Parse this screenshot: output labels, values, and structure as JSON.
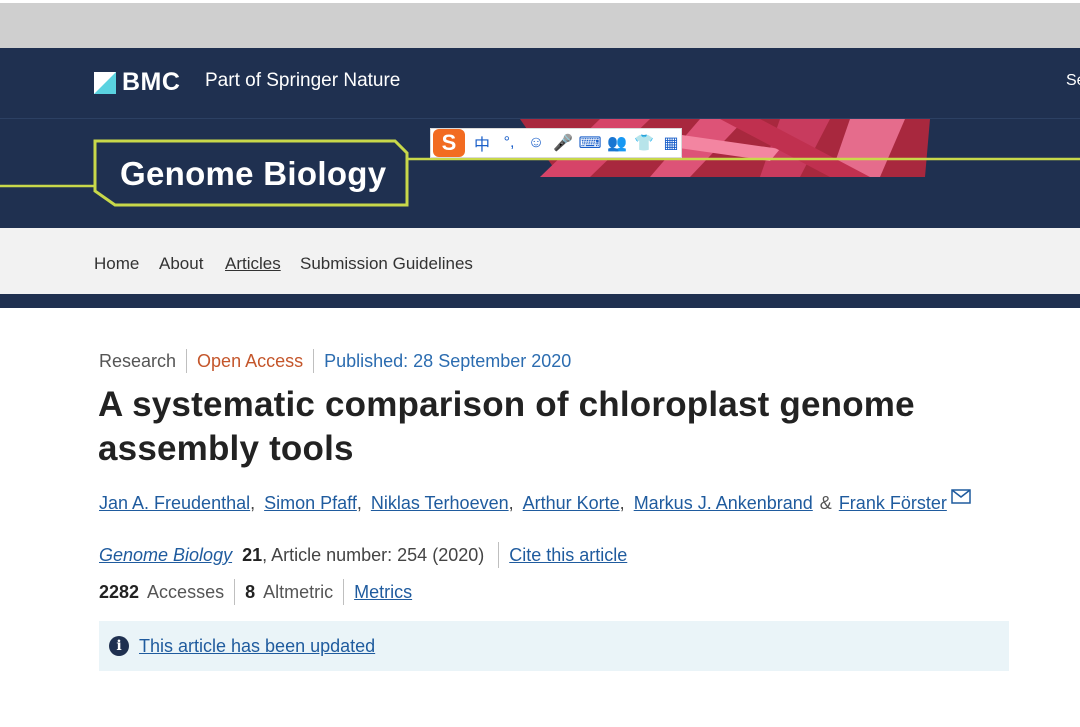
{
  "brand": {
    "logo_text": "BMC",
    "subtitle": "Part of Springer Nature",
    "right_text": "Se"
  },
  "journal": {
    "title": "Genome Biology"
  },
  "ime_toolbar": {
    "logo": "S",
    "items": [
      "中",
      "°,",
      "☺",
      "🎤",
      "⌨",
      "👥",
      "👕",
      "▦"
    ]
  },
  "nav": {
    "items": [
      "Home",
      "About",
      "Articles",
      "Submission Guidelines"
    ],
    "active": "Articles"
  },
  "article": {
    "type": "Research",
    "access": "Open Access",
    "published": "Published: 28 September 2020",
    "title": "A systematic comparison of chloroplast genome assembly tools",
    "authors": [
      "Jan A. Freudenthal",
      "Simon Pfaff",
      "Niklas Terhoeven",
      "Arthur Korte",
      "Markus J. Ankenbrand",
      "Frank Förster"
    ],
    "amp": "&",
    "journal_name": "Genome Biology",
    "volume": "21",
    "article_number": ", Article number: 254 (2020)",
    "cite_label": "Cite this article",
    "accesses_count": "2282",
    "accesses_label": "Accesses",
    "altmetric_count": "8",
    "altmetric_label": "Altmetric",
    "metrics_label": "Metrics",
    "update_notice": "This article has been updated"
  },
  "colors": {
    "navy": "#1f3050",
    "accent_green": "#c8d84a",
    "open_access": "#c4562b",
    "link": "#1f5b9e",
    "ime_orange": "#f26b21"
  }
}
